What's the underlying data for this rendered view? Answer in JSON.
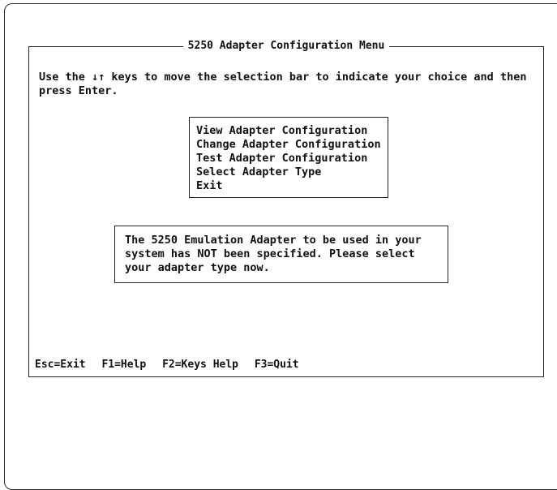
{
  "title": "5250 Adapter Configuration Menu",
  "instruction": "Use the ↓↑ keys to move the selection bar to indicate your choice and then press Enter.",
  "menu": {
    "items": [
      "View Adapter Configuration",
      "Change Adapter Configuration",
      "Test Adapter Configuration",
      "Select Adapter Type",
      "Exit"
    ]
  },
  "message": {
    "lines": [
      "The 5250 Emulation Adapter to be used in your",
      "system has NOT been specified.  Please select",
      "your adapter type now."
    ]
  },
  "function_keys": [
    "Esc=Exit",
    "F1=Help",
    "F2=Keys Help",
    "F3=Quit"
  ]
}
